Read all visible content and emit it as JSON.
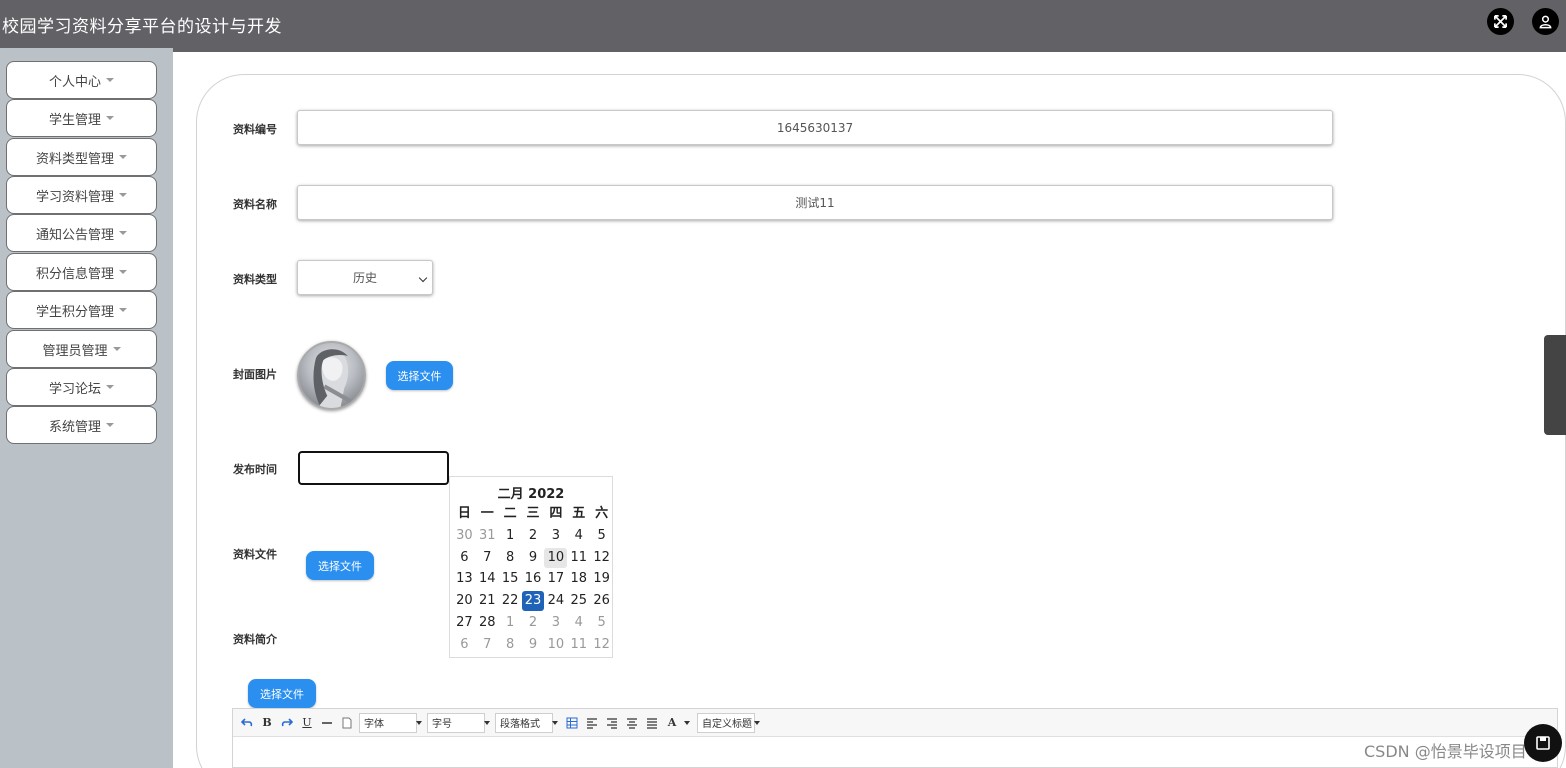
{
  "header": {
    "title": "校园学习资料分享平台的设计与开发",
    "fullscreen_icon": "fullscreen-icon",
    "user_icon": "user-icon"
  },
  "sidebar": {
    "items": [
      {
        "label": "个人中心"
      },
      {
        "label": "学生管理"
      },
      {
        "label": "资料类型管理"
      },
      {
        "label": "学习资料管理"
      },
      {
        "label": "通知公告管理"
      },
      {
        "label": "积分信息管理"
      },
      {
        "label": "学生积分管理"
      },
      {
        "label": "管理员管理"
      },
      {
        "label": "学习论坛"
      },
      {
        "label": "系统管理"
      }
    ]
  },
  "form": {
    "code_label": "资料编号",
    "code_value": "1645630137",
    "name_label": "资料名称",
    "name_value": "测试11",
    "type_label": "资料类型",
    "type_value": "历史",
    "cover_label": "封面图片",
    "cover_button": "选择文件",
    "date_label": "发布时间",
    "date_value": "",
    "file_label": "资料文件",
    "file_button": "选择文件",
    "intro_label": "资料简介",
    "intro_button": "选择文件"
  },
  "calendar": {
    "title": "二月 2022",
    "weekdays": [
      "日",
      "一",
      "二",
      "三",
      "四",
      "五",
      "六"
    ],
    "weeks": [
      [
        {
          "d": "30",
          "m": true
        },
        {
          "d": "31",
          "m": true
        },
        {
          "d": "1"
        },
        {
          "d": "2"
        },
        {
          "d": "3"
        },
        {
          "d": "4"
        },
        {
          "d": "5"
        }
      ],
      [
        {
          "d": "6"
        },
        {
          "d": "7"
        },
        {
          "d": "8"
        },
        {
          "d": "9"
        },
        {
          "d": "10",
          "h": true
        },
        {
          "d": "11"
        },
        {
          "d": "12"
        }
      ],
      [
        {
          "d": "13"
        },
        {
          "d": "14"
        },
        {
          "d": "15"
        },
        {
          "d": "16"
        },
        {
          "d": "17"
        },
        {
          "d": "18"
        },
        {
          "d": "19"
        }
      ],
      [
        {
          "d": "20"
        },
        {
          "d": "21"
        },
        {
          "d": "22"
        },
        {
          "d": "23",
          "s": true
        },
        {
          "d": "24"
        },
        {
          "d": "25"
        },
        {
          "d": "26"
        }
      ],
      [
        {
          "d": "27"
        },
        {
          "d": "28"
        },
        {
          "d": "1",
          "m": true
        },
        {
          "d": "2",
          "m": true
        },
        {
          "d": "3",
          "m": true
        },
        {
          "d": "4",
          "m": true
        },
        {
          "d": "5",
          "m": true
        }
      ],
      [
        {
          "d": "6",
          "m": true
        },
        {
          "d": "7",
          "m": true
        },
        {
          "d": "8",
          "m": true
        },
        {
          "d": "9",
          "m": true
        },
        {
          "d": "10",
          "m": true
        },
        {
          "d": "11",
          "m": true
        },
        {
          "d": "12",
          "m": true
        }
      ]
    ]
  },
  "editor": {
    "font_label": "字体",
    "size_label": "字号",
    "paragraph_label": "段落格式",
    "custom_title_label": "自定义标题",
    "bold": "B",
    "underline": "U",
    "font_color": "A"
  },
  "watermark": "CSDN @怡景毕设项目",
  "colors": {
    "header_bg": "#626266",
    "sidebar_bg": "#bac1c7",
    "accent": "#2b8ff0",
    "selected_day": "#1f63b8"
  }
}
